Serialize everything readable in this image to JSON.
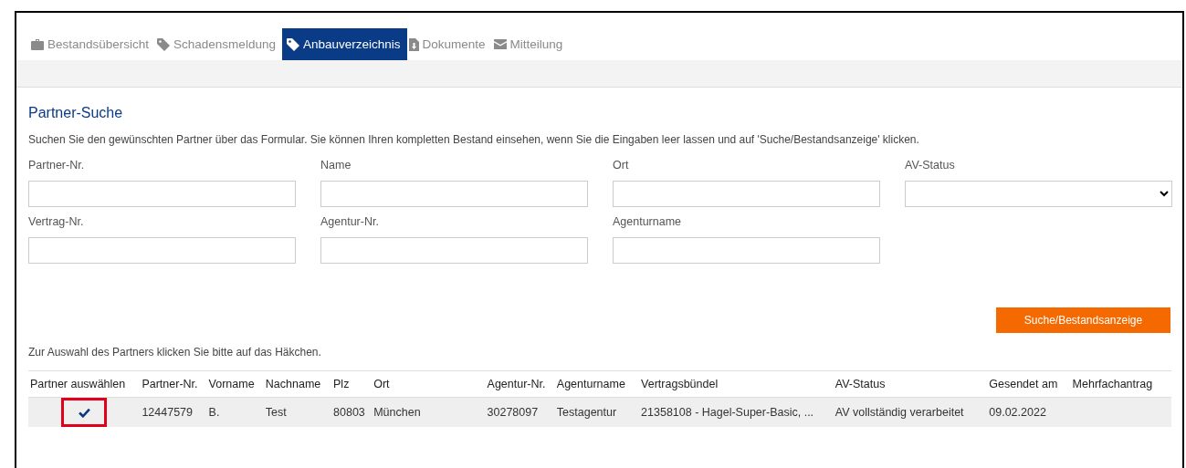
{
  "tabs": [
    {
      "label": "Bestandsübersicht",
      "selected": false
    },
    {
      "label": "Schadensmeldung",
      "selected": false
    },
    {
      "label": "Anbauverzeichnis",
      "selected": true
    },
    {
      "label": "Dokumente",
      "selected": false
    },
    {
      "label": "Mitteilung",
      "selected": false
    }
  ],
  "search": {
    "title": "Partner-Suche",
    "intro": "Suchen Sie den gewünschten Partner über das Formular. Sie können Ihren kompletten Bestand einsehen, wenn Sie die Eingaben leer lassen und auf 'Suche/Bestandsanzeige' klicken.",
    "fields": [
      {
        "label": "Partner-Nr.",
        "kind": "text"
      },
      {
        "label": "Name",
        "kind": "text"
      },
      {
        "label": "Ort",
        "kind": "text"
      },
      {
        "label": "AV-Status",
        "kind": "select"
      },
      {
        "label": "Vertrag-Nr.",
        "kind": "text"
      },
      {
        "label": "Agentur-Nr.",
        "kind": "text"
      },
      {
        "label": "Agenturname",
        "kind": "text"
      }
    ],
    "button": "Suche/Bestandsanzeige"
  },
  "hint": "Zur Auswahl des Partners klicken Sie bitte auf das Häkchen.",
  "table": {
    "columns": [
      "Partner auswählen",
      "Partner-Nr.",
      "Vorname",
      "Nachname",
      "Plz",
      "Ort",
      "Agentur-Nr.",
      "Agenturname",
      "Vertragsbündel",
      "AV-Status",
      "Gesendet am",
      "Mehrfachantrag"
    ],
    "rows": [
      {
        "highlighted": true,
        "cells": [
          "",
          "12447579",
          "B.",
          "Test",
          "80803",
          "München",
          "30278097",
          "Testagentur",
          "21358108 - Hagel-Super-Basic, ...",
          "AV vollständig verarbeitet",
          "09.02.2022",
          ""
        ]
      }
    ]
  }
}
